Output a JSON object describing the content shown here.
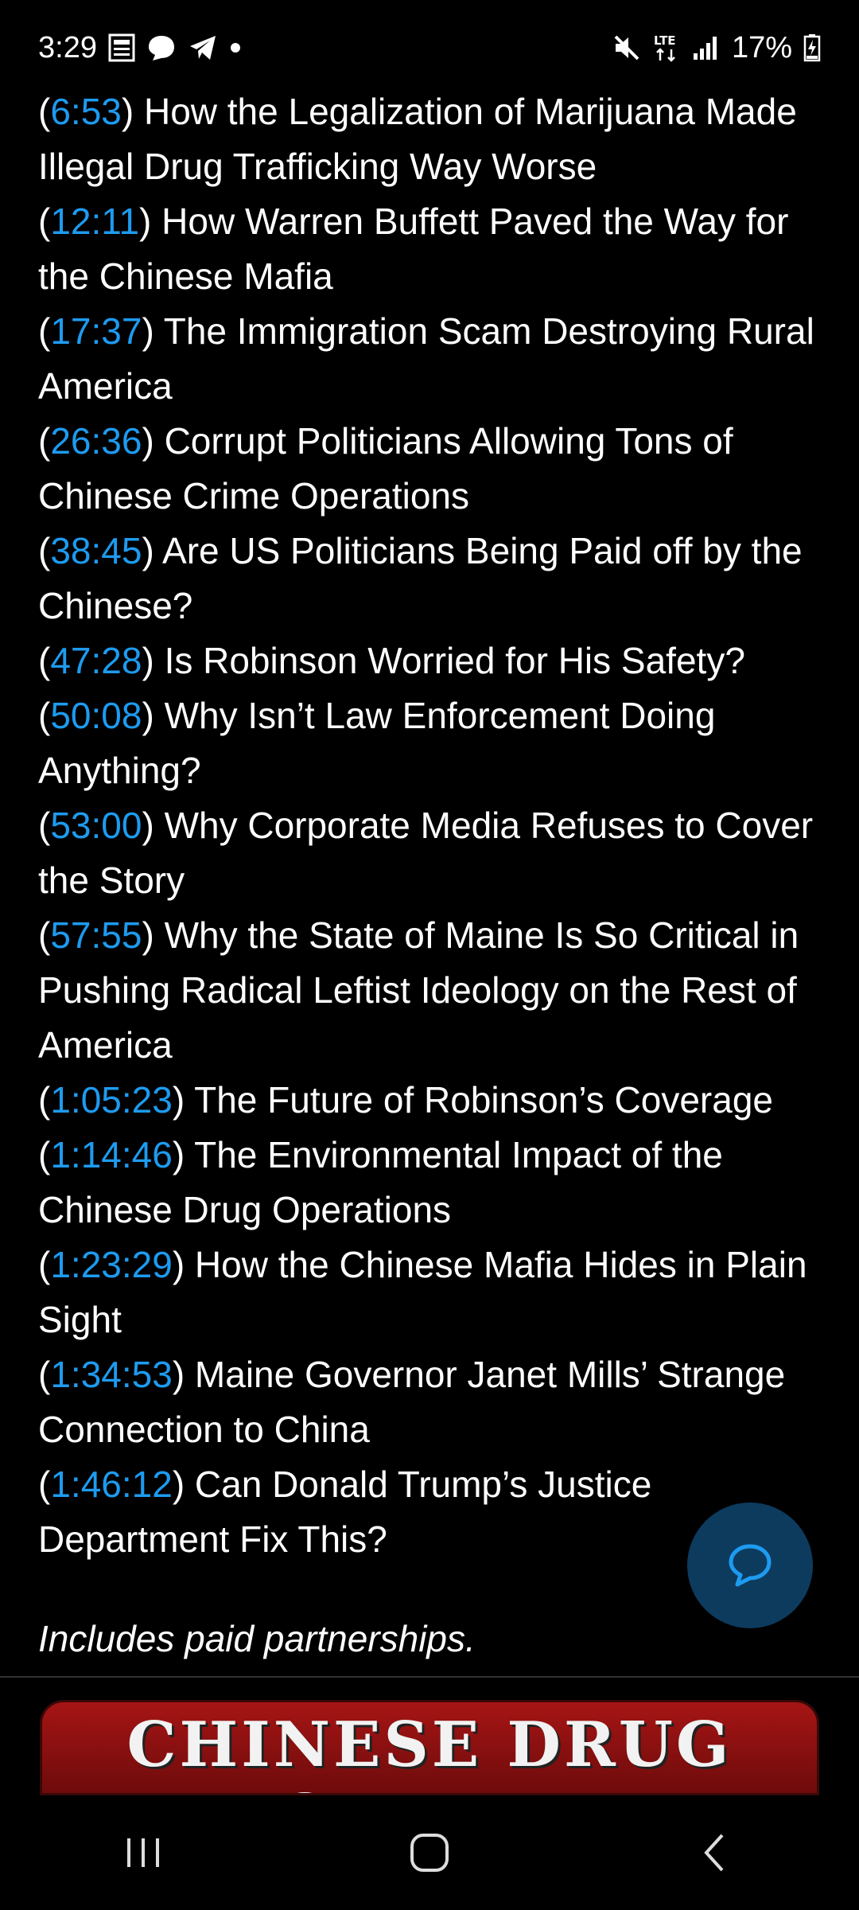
{
  "status_bar": {
    "time": "3:29",
    "left_icons": [
      "news-icon",
      "chat-bubble-icon",
      "telegram-icon",
      "dot-icon"
    ],
    "right_icons": [
      "mute-icon",
      "lte-icon",
      "signal-icon"
    ],
    "battery_text": "17%"
  },
  "chapters": [
    {
      "ts": "6:53",
      "title": "How the Legalization of Marijuana Made Illegal Drug Trafficking Way Worse"
    },
    {
      "ts": "12:11",
      "title": "How Warren Buffett Paved the Way for the Chinese Mafia"
    },
    {
      "ts": "17:37",
      "title": "The Immigration Scam Destroying Rural America"
    },
    {
      "ts": "26:36",
      "title": "Corrupt Politicians Allowing Tons of Chinese Crime Operations"
    },
    {
      "ts": "38:45",
      "title": "Are US Politicians Being Paid off by the Chinese?"
    },
    {
      "ts": "47:28",
      "title": "Is Robinson Worried for His Safety?"
    },
    {
      "ts": "50:08",
      "title": "Why Isn’t Law Enforcement Doing Anything?"
    },
    {
      "ts": "53:00",
      "title": "Why Corporate Media Refuses to Cover the Story"
    },
    {
      "ts": "57:55",
      "title": "Why the State of Maine Is So Critical in Pushing Radical Leftist Ideology on the Rest of America"
    },
    {
      "ts": "1:05:23",
      "title": "The Future of Robinson’s Coverage"
    },
    {
      "ts": "1:14:46",
      "title": "The Environmental Impact of the Chinese Drug Operations"
    },
    {
      "ts": "1:23:29",
      "title": "How the Chinese Mafia Hides in Plain Sight"
    },
    {
      "ts": "1:34:53",
      "title": "Maine Governor Janet Mills’ Strange Connection to China"
    },
    {
      "ts": "1:46:12",
      "title": "Can Donald Trump’s Justice Department Fix This?"
    }
  ],
  "paid_note": "Includes paid partnerships.",
  "thumbnail_title": "CHINESE DRUG CARTEL",
  "fab_icon": "reply-icon",
  "nav": {
    "icons": [
      "recent-apps-icon",
      "home-icon",
      "back-icon"
    ]
  },
  "colors": {
    "link": "#1d9bf0",
    "fab": "#0d3b5e",
    "background": "#000000"
  }
}
